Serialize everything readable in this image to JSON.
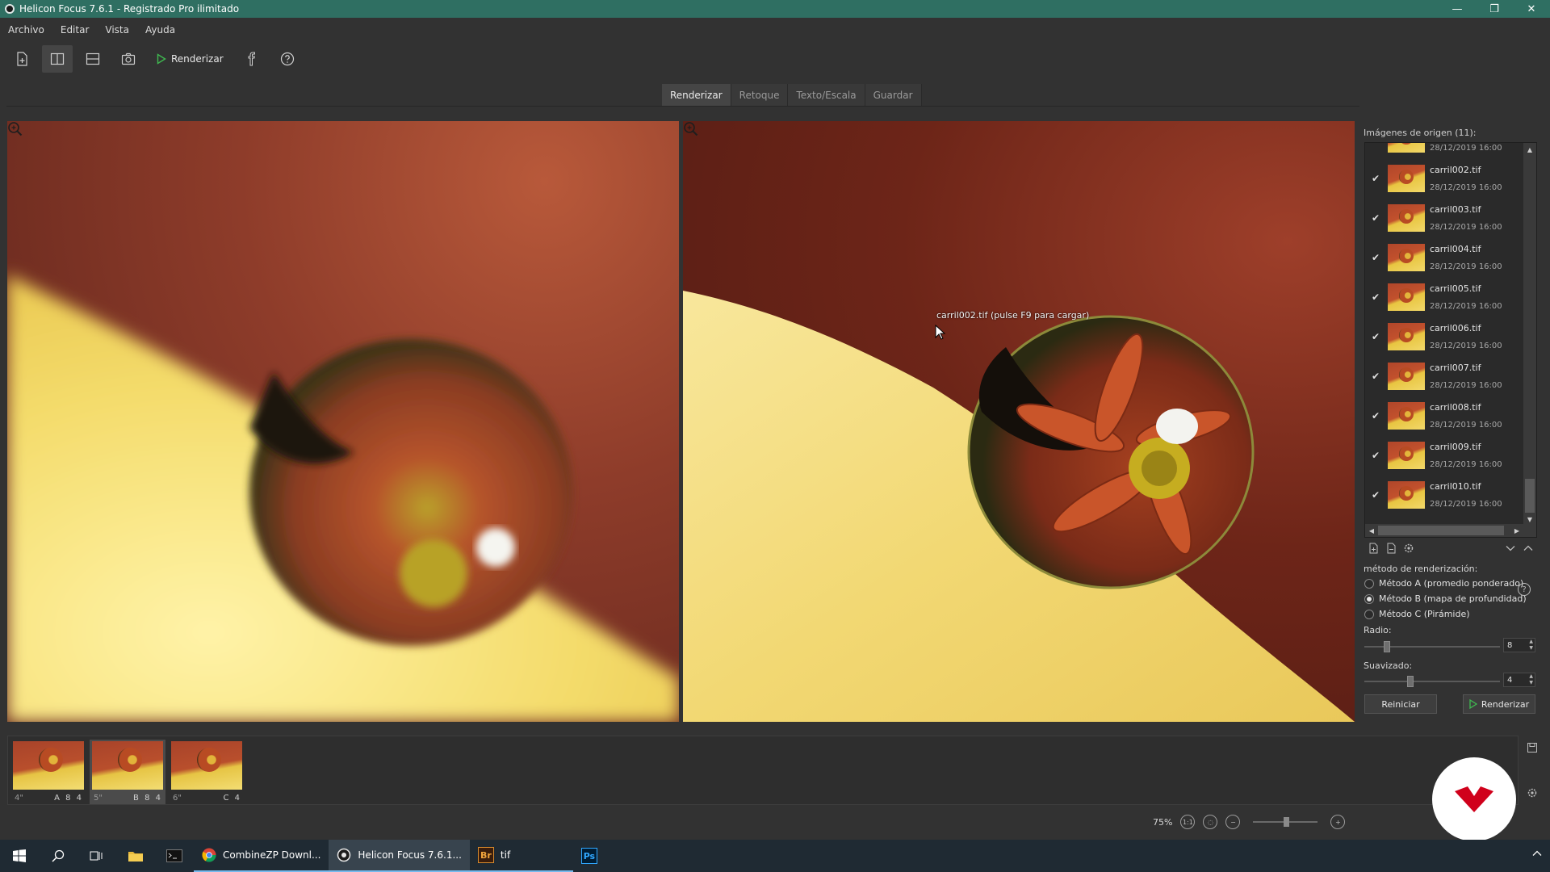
{
  "window": {
    "title": "Helicon Focus 7.6.1 - Registrado Pro ilimitado",
    "controls": {
      "minimize": "—",
      "maximize": "❐",
      "close": "✕"
    }
  },
  "menu": [
    "Archivo",
    "Editar",
    "Vista",
    "Ayuda"
  ],
  "toolbar": {
    "render_label": "Renderizar"
  },
  "tabs": [
    {
      "label": "Renderizar",
      "active": true
    },
    {
      "label": "Retoque",
      "active": false
    },
    {
      "label": "Texto/Escala",
      "active": false
    },
    {
      "label": "Guardar",
      "active": false
    }
  ],
  "viewer": {
    "tooltip": "carril002.tif (pulse F9 para cargar)"
  },
  "sources": {
    "title": "Imágenes de origen (11):",
    "first_partial_date": "28/12/2019 16:00",
    "items": [
      {
        "name": "carril002.tif",
        "date": "28/12/2019 16:00",
        "checked": true
      },
      {
        "name": "carril003.tif",
        "date": "28/12/2019 16:00",
        "checked": true
      },
      {
        "name": "carril004.tif",
        "date": "28/12/2019 16:00",
        "checked": true
      },
      {
        "name": "carril005.tif",
        "date": "28/12/2019 16:00",
        "checked": true
      },
      {
        "name": "carril006.tif",
        "date": "28/12/2019 16:00",
        "checked": true
      },
      {
        "name": "carril007.tif",
        "date": "28/12/2019 16:00",
        "checked": true
      },
      {
        "name": "carril008.tif",
        "date": "28/12/2019 16:00",
        "checked": true
      },
      {
        "name": "carril009.tif",
        "date": "28/12/2019 16:00",
        "checked": true
      },
      {
        "name": "carril010.tif",
        "date": "28/12/2019 16:00",
        "checked": true
      }
    ]
  },
  "render_method": {
    "title": "método de renderización:",
    "options": [
      {
        "label": "Método A (promedio ponderado)",
        "selected": false
      },
      {
        "label": "Método B (mapa de profundidad)",
        "selected": true
      },
      {
        "label": "Método C (Pirámide)",
        "selected": false
      }
    ],
    "radius": {
      "label": "Radio:",
      "value": "8",
      "level": 0.15
    },
    "smoothing": {
      "label": "Suavizado:",
      "value": "4",
      "level": 0.33
    },
    "reset_label": "Reiniciar",
    "render_label": "Renderizar"
  },
  "filmstrip": [
    {
      "num": "4\"",
      "code": "A 8 4",
      "selected": false
    },
    {
      "num": "5\"",
      "code": "B 8 4",
      "selected": true
    },
    {
      "num": "6\"",
      "code": "C 4",
      "selected": false
    }
  ],
  "zoom": {
    "level": "75%",
    "fit_label": "1:1"
  },
  "taskbar": {
    "apps": [
      {
        "label": "CombineZP Downl...",
        "active": false
      },
      {
        "label": "Helicon Focus 7.6.1...",
        "active": true
      },
      {
        "label": "tif",
        "active": false
      },
      {
        "label": "",
        "active": false
      }
    ],
    "icons": {
      "bridge": "Br",
      "photoshop": "Ps"
    }
  },
  "colors": {
    "titlebar": "#2f6f62",
    "accent_green": "#3fb950",
    "logo_red": "#d0001b"
  }
}
